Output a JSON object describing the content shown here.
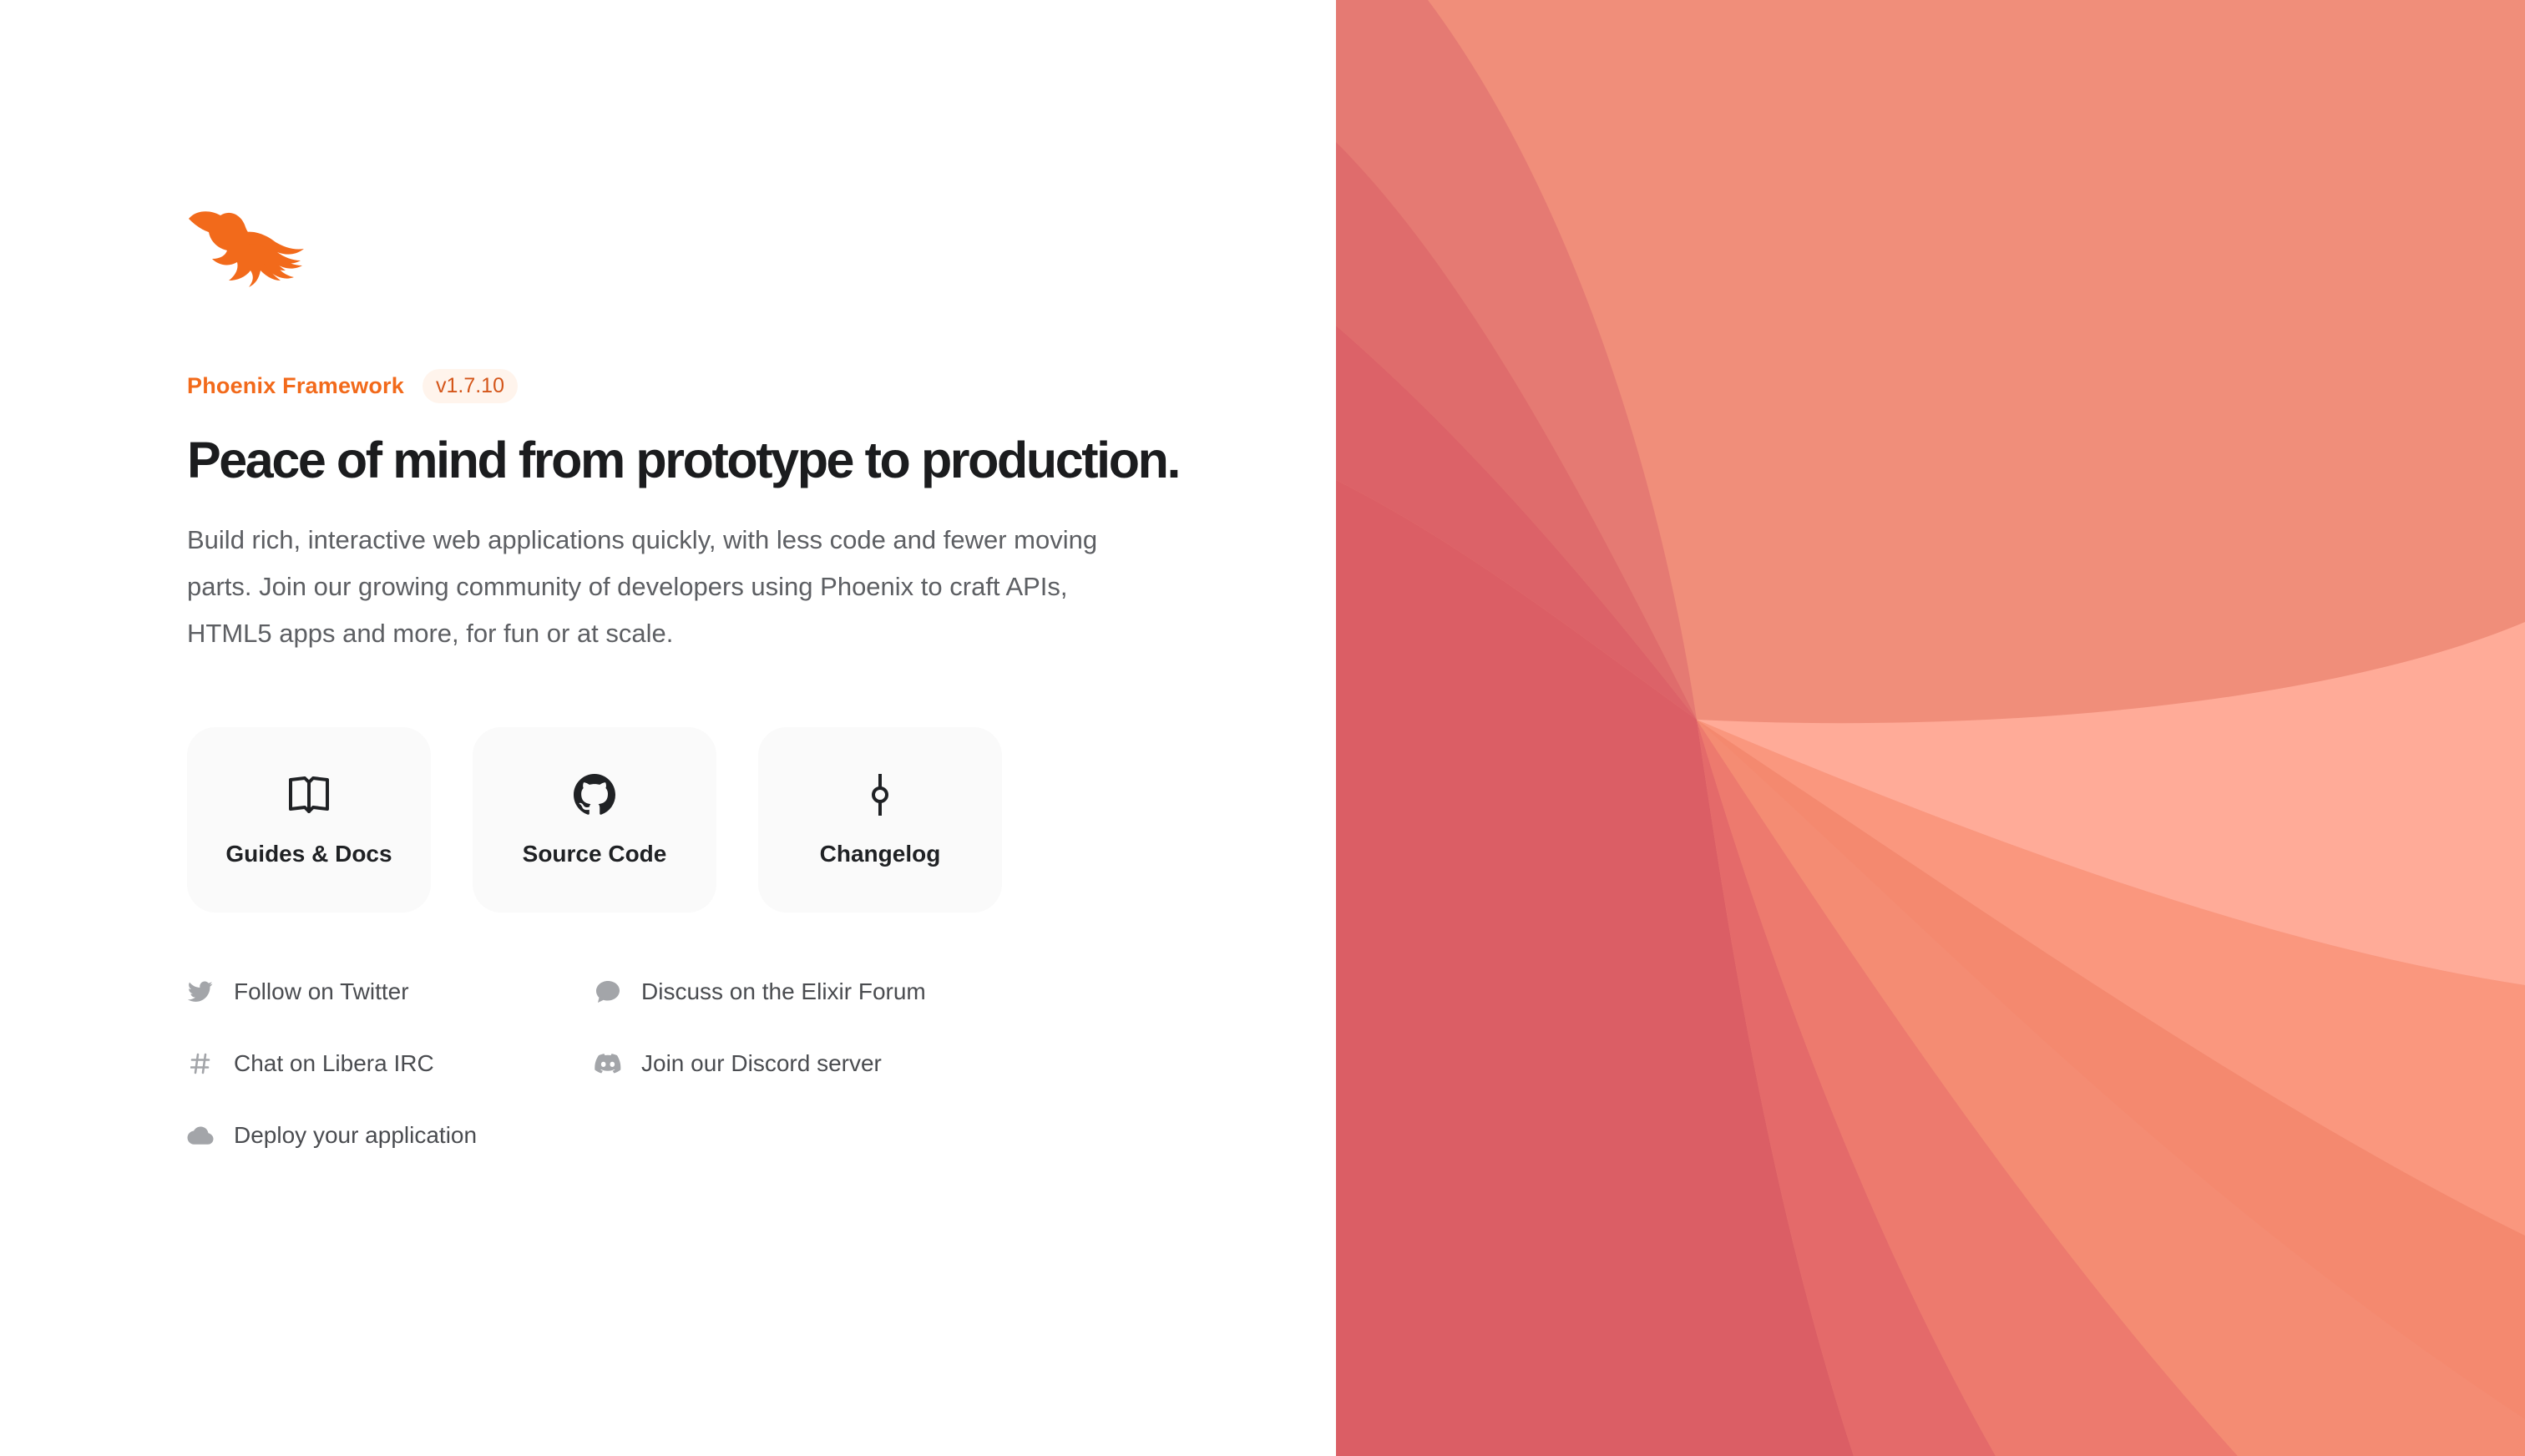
{
  "header": {
    "brand": "Phoenix Framework",
    "version": "v1.7.10",
    "logo_icon": "phoenix-logo"
  },
  "hero": {
    "headline": "Peace of mind from prototype to production.",
    "description": "Build rich, interactive web applications quickly, with less code and fewer moving parts. Join our growing community of developers using Phoenix to craft APIs, HTML5 apps and more, for fun or at scale."
  },
  "cards": [
    {
      "label": "Guides & Docs",
      "icon": "book-icon"
    },
    {
      "label": "Source Code",
      "icon": "github-icon"
    },
    {
      "label": "Changelog",
      "icon": "commit-icon"
    }
  ],
  "links": [
    {
      "label": "Follow on Twitter",
      "icon": "twitter-icon"
    },
    {
      "label": "Discuss on the Elixir Forum",
      "icon": "chat-bubble-icon"
    },
    {
      "label": "Chat on Libera IRC",
      "icon": "hashtag-icon"
    },
    {
      "label": "Join our Discord server",
      "icon": "discord-icon"
    },
    {
      "label": "Deploy your application",
      "icon": "cloud-icon"
    }
  ],
  "colors": {
    "brand": "#f26a1b",
    "headline": "#1b1c1e",
    "text": "#5d5f63",
    "card_bg": "#fafafa",
    "art_primary": "#f08f7b",
    "art_accent": "#db5e64"
  }
}
